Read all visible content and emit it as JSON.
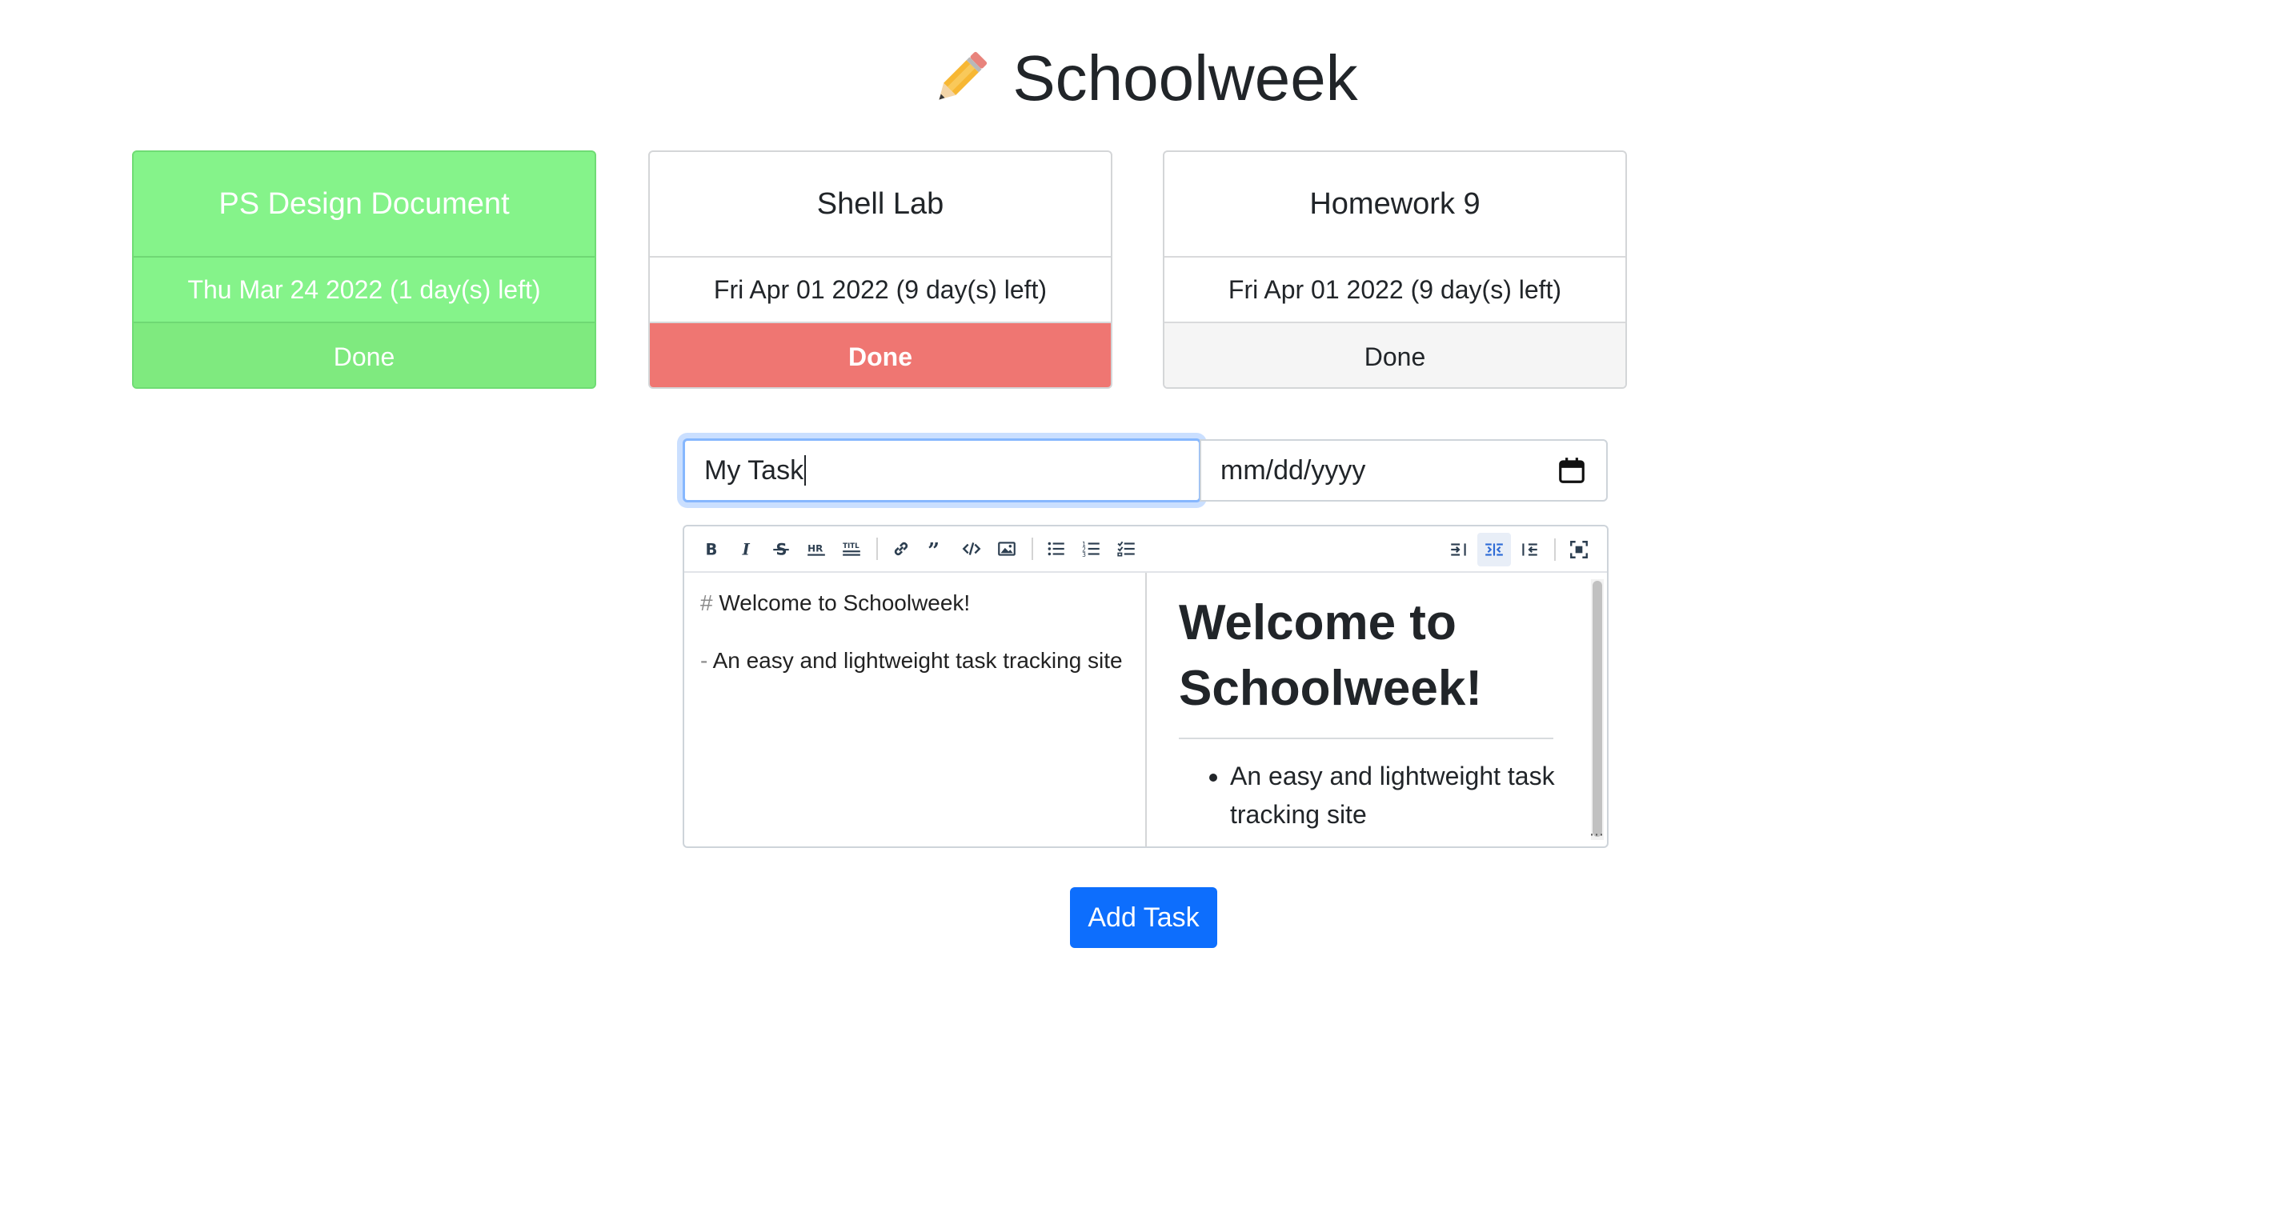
{
  "page": {
    "title": "Schoolweek"
  },
  "tasks": [
    {
      "title": "PS Design Document",
      "due": "Thu Mar 24 2022 (1 day(s) left)",
      "action": "Done",
      "status": "done"
    },
    {
      "title": "Shell Lab",
      "due": "Fri Apr 01 2022 (9 day(s) left)",
      "action": "Done",
      "status": "urgent"
    },
    {
      "title": "Homework 9",
      "due": "Fri Apr 01 2022 (9 day(s) left)",
      "action": "Done",
      "status": "normal"
    }
  ],
  "form": {
    "task_name_value": "My Task",
    "date_placeholder": "mm/dd/yyyy",
    "add_button_label": "Add Task"
  },
  "editor": {
    "source_heading_marker": "#",
    "source_heading": "Welcome to Schoolweek!",
    "source_list_marker": "-",
    "source_list_item": "An easy and lightweight task tracking site",
    "preview_heading": "Welcome to Schoolweek!",
    "preview_list_item": "An easy and lightweight task tracking site",
    "toolbar_icons": [
      "bold-icon",
      "italic-icon",
      "strikethrough-icon",
      "horizontal-rule-icon",
      "title-icon",
      "link-icon",
      "quote-icon",
      "code-icon",
      "image-icon",
      "unordered-list-icon",
      "ordered-list-icon",
      "checklist-icon",
      "edit-mode-icon",
      "split-mode-icon",
      "preview-mode-icon",
      "fullscreen-icon"
    ]
  },
  "colors": {
    "done_green": "#85f38a",
    "urgent_red": "#ef7672",
    "primary_blue": "#0d6efd"
  }
}
